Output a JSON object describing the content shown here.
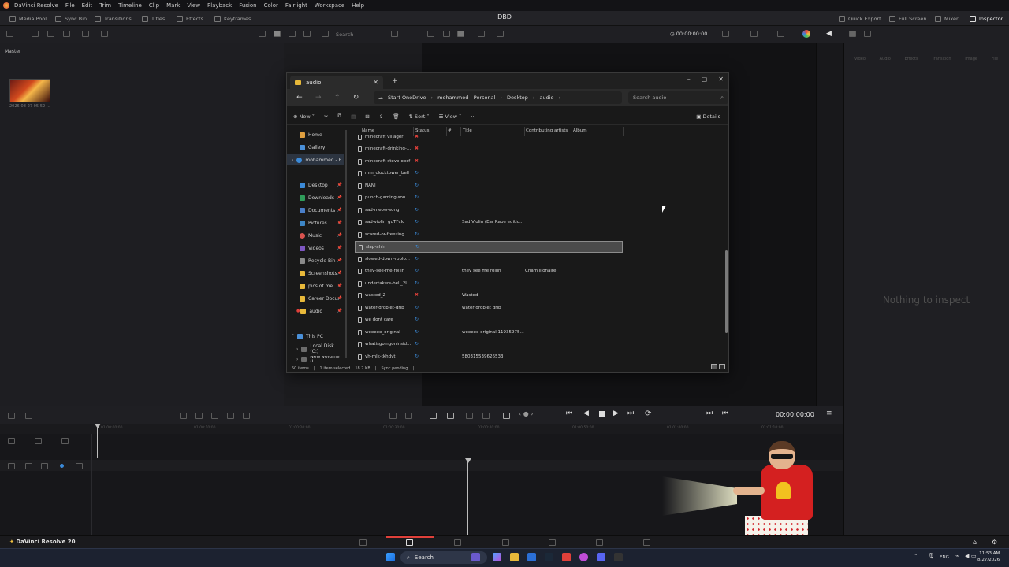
{
  "menubar": {
    "app_name": "DaVinci Resolve",
    "items": [
      "File",
      "Edit",
      "Trim",
      "Timeline",
      "Clip",
      "Mark",
      "View",
      "Playback",
      "Fusion",
      "Color",
      "Fairlight",
      "Workspace",
      "Help"
    ]
  },
  "project_title": "DBD",
  "toolbar": {
    "media_pool": "Media Pool",
    "sync_bin": "Sync Bin",
    "transitions": "Transitions",
    "titles": "Titles",
    "effects": "Effects",
    "keyframes": "Keyframes",
    "quick_export": "Quick Export",
    "full_screen": "Full Screen",
    "mixer": "Mixer",
    "inspector": "Inspector"
  },
  "media": {
    "search_placeholder": "Search",
    "bin_label": "Master",
    "thumb_caption": "2026-08-27 05-52-...",
    "timecode_top": "00:00:00:00"
  },
  "inspector": {
    "tabs": [
      "Video",
      "Audio",
      "Effects",
      "Transition",
      "Image",
      "File"
    ],
    "empty_message": "Nothing to inspect"
  },
  "explorer": {
    "tab_title": "audio",
    "breadcrumb": [
      "Start OneDrive",
      "mohammed - Personal",
      "Desktop",
      "audio"
    ],
    "search_placeholder": "Search audio",
    "commands": {
      "new": "New",
      "sort": "Sort",
      "view": "View",
      "details": "Details"
    },
    "nav_items": [
      {
        "label": "Home",
        "color": "#e0a040",
        "pin": false
      },
      {
        "label": "Gallery",
        "color": "#4a90d9",
        "pin": false
      },
      {
        "label": "mohammed - P",
        "color": "#3b8ad8",
        "pin": false,
        "selected": true
      },
      {
        "label": "Desktop",
        "color": "#3b8ad8",
        "pin": true
      },
      {
        "label": "Downloads",
        "color": "#2f9c5a",
        "pin": true
      },
      {
        "label": "Documents",
        "color": "#4a7fc9",
        "pin": true
      },
      {
        "label": "Pictures",
        "color": "#3d86c6",
        "pin": true
      },
      {
        "label": "Music",
        "color": "#d9534f",
        "pin": true
      },
      {
        "label": "Videos",
        "color": "#7e57c2",
        "pin": true
      },
      {
        "label": "Recycle Bin",
        "color": "#8a8a8a",
        "pin": true
      },
      {
        "label": "Screenshots",
        "color": "#e8b93a",
        "pin": true
      },
      {
        "label": "pics of me",
        "color": "#e8b93a",
        "pin": true
      },
      {
        "label": "Career Docur",
        "color": "#e8b93a",
        "pin": true
      },
      {
        "label": "audio",
        "color": "#e8b93a",
        "pin": true
      },
      {
        "label": "This PC",
        "color": "#4a90d9",
        "pin": false
      },
      {
        "label": "Local Disk (C:)",
        "color": "#6c6c6c",
        "pin": false
      },
      {
        "label": "New Volume (I",
        "color": "#6c6c6c",
        "pin": false
      }
    ],
    "columns": [
      "Name",
      "Status",
      "#",
      "Title",
      "Contributing artists",
      "Album"
    ],
    "files": [
      {
        "name": "minecraft villager",
        "status": "error",
        "title": "",
        "artist": ""
      },
      {
        "name": "minecraft-drinking-...",
        "status": "error",
        "title": "",
        "artist": ""
      },
      {
        "name": "minecraft-steve-oocf",
        "status": "error",
        "title": "",
        "artist": ""
      },
      {
        "name": "mm_clocktower_bell",
        "status": "sync",
        "title": "",
        "artist": ""
      },
      {
        "name": "NANI",
        "status": "sync",
        "title": "",
        "artist": ""
      },
      {
        "name": "punch-gaming-sou...",
        "status": "sync",
        "title": "",
        "artist": ""
      },
      {
        "name": "sad-meow-song",
        "status": "sync",
        "title": "",
        "artist": ""
      },
      {
        "name": "sad-violin_guTFcIc",
        "status": "sync",
        "title": "Sad Violin (Ear Rape editio...",
        "artist": ""
      },
      {
        "name": "scared-or-freezing",
        "status": "sync",
        "title": "",
        "artist": ""
      },
      {
        "name": "slap-ahh",
        "status": "sync",
        "title": "",
        "artist": "",
        "selected": true
      },
      {
        "name": "slowed-down-roblo...",
        "status": "sync",
        "title": "",
        "artist": ""
      },
      {
        "name": "they-see-me-rollin",
        "status": "sync",
        "title": "they see me rollin",
        "artist": "Chamillionaire"
      },
      {
        "name": "undertakers-bell_2U...",
        "status": "sync",
        "title": "",
        "artist": ""
      },
      {
        "name": "wasted_2",
        "status": "error",
        "title": "Wasted",
        "artist": ""
      },
      {
        "name": "water-droplet-drip",
        "status": "sync",
        "title": "water droplet drip",
        "artist": ""
      },
      {
        "name": "we dont care",
        "status": "sync",
        "title": "",
        "artist": ""
      },
      {
        "name": "weeeee_original",
        "status": "sync",
        "title": "weeeee original 11935975...",
        "artist": ""
      },
      {
        "name": "whatisgoingoninsid...",
        "status": "sync",
        "title": "",
        "artist": ""
      },
      {
        "name": "yh-mlk-tkhdyt",
        "status": "sync",
        "title": "580315539626533",
        "artist": ""
      }
    ],
    "status": {
      "count": "50 items",
      "selected": "1 item selected",
      "size": "18.7 KB",
      "sync": "Sync pending"
    }
  },
  "transport": {
    "timecode": "00:00:00:00"
  },
  "ruler_ticks": [
    "01:00:00:00",
    "01:00:10:00",
    "01:00:20:00",
    "01:00:30:00",
    "01:00:40:00",
    "01:00:50:00",
    "01:01:00:00",
    "01:01:10:00"
  ],
  "pagebar": {
    "brand": "DaVinci Resolve 20"
  },
  "taskbar": {
    "search": "Search",
    "lang": "ENG",
    "time": "11:53 AM",
    "date": "8/27/2026"
  },
  "colors": {
    "sync": "#3b8ad8",
    "error": "#e0403a",
    "accent": "#e0403a"
  }
}
